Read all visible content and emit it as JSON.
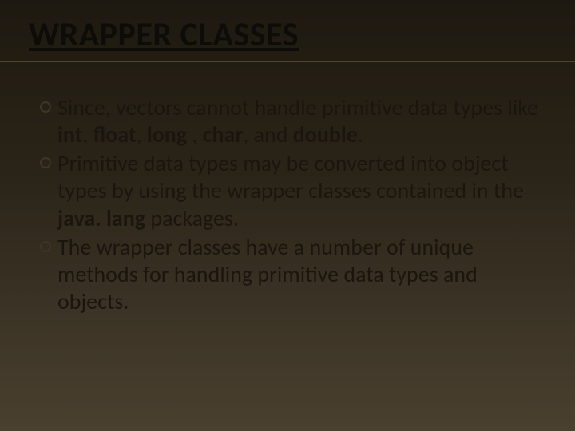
{
  "title": "WRAPPER CLASSES",
  "bullets": {
    "b1": {
      "p1": "Since, vectors cannot handle primitive data types like ",
      "int": "int",
      "c1": ", ",
      "float": "float",
      "c2": ", ",
      "long": "long",
      "c3": " , ",
      "char": "char",
      "c4": ", and ",
      "double": "double",
      "c5": "."
    },
    "b2": {
      "p1": "Primitive data types may be converted into object types by using the wrapper classes contained in the ",
      "pkg": "java. lang",
      "p2": " packages."
    },
    "b3": {
      "p1": "The wrapper classes have a number of unique methods for handling primitive data types and objects."
    }
  }
}
